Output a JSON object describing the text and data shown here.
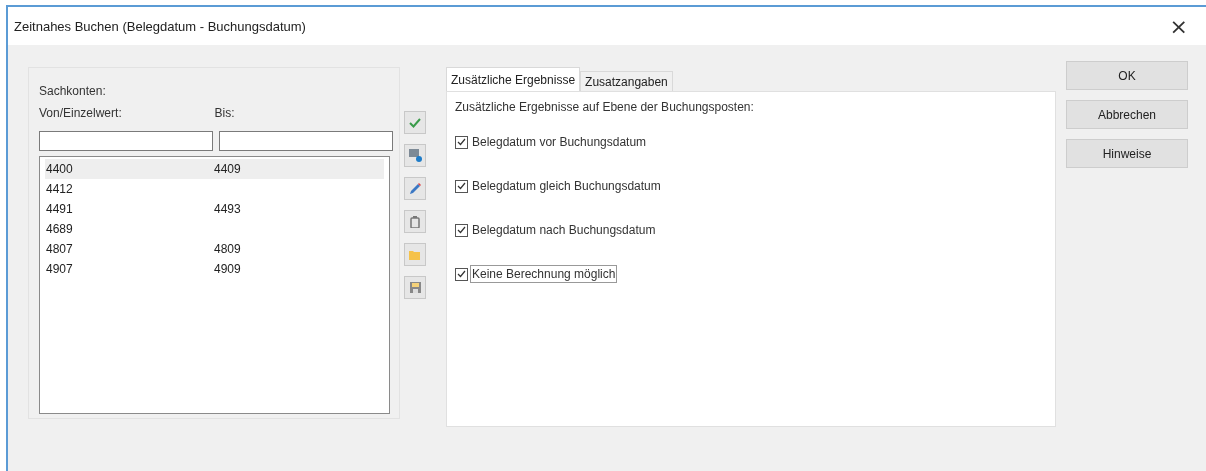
{
  "window": {
    "title": "Zeitnahes Buchen (Belegdatum - Buchungsdatum)",
    "close": "×"
  },
  "accounts": {
    "title": "Sachkonten:",
    "from_label": "Von/Einzelwert:",
    "to_label": "Bis:",
    "rows": [
      {
        "from": "4400",
        "to": "4409",
        "selected": true
      },
      {
        "from": "4412",
        "selected": false
      },
      {
        "from": "4491",
        "to": "4493",
        "selected": false
      },
      {
        "from": "4689",
        "selected": false
      },
      {
        "from": "4807",
        "to": "4809",
        "selected": false
      },
      {
        "from": "4907",
        "to": "4909",
        "selected": false
      }
    ]
  },
  "toolbar": [
    {
      "kind": "apply"
    },
    {
      "kind": "new"
    },
    {
      "kind": "edit"
    },
    {
      "kind": "delete"
    },
    {
      "kind": "open"
    },
    {
      "kind": "save"
    }
  ],
  "tabs": [
    {
      "label": "Zusätzliche Ergebnisse",
      "selected": true
    },
    {
      "label": "Zusatzangaben",
      "selected": false
    }
  ],
  "panel": {
    "heading": "Zusätzliche Ergebnisse auf Ebene der Buchungsposten:",
    "options": [
      {
        "label": "Belegdatum vor Buchungsdatum",
        "checked": true,
        "focused": false
      },
      {
        "label": "Belegdatum gleich Buchungsdatum",
        "checked": true,
        "focused": false
      },
      {
        "label": "Belegdatum nach Buchungsdatum",
        "checked": true,
        "focused": false
      },
      {
        "label": "Keine Berechnung möglich",
        "checked": true,
        "focused": true
      }
    ]
  },
  "buttons": [
    "OK",
    "Abbrechen",
    "Hinweise"
  ]
}
